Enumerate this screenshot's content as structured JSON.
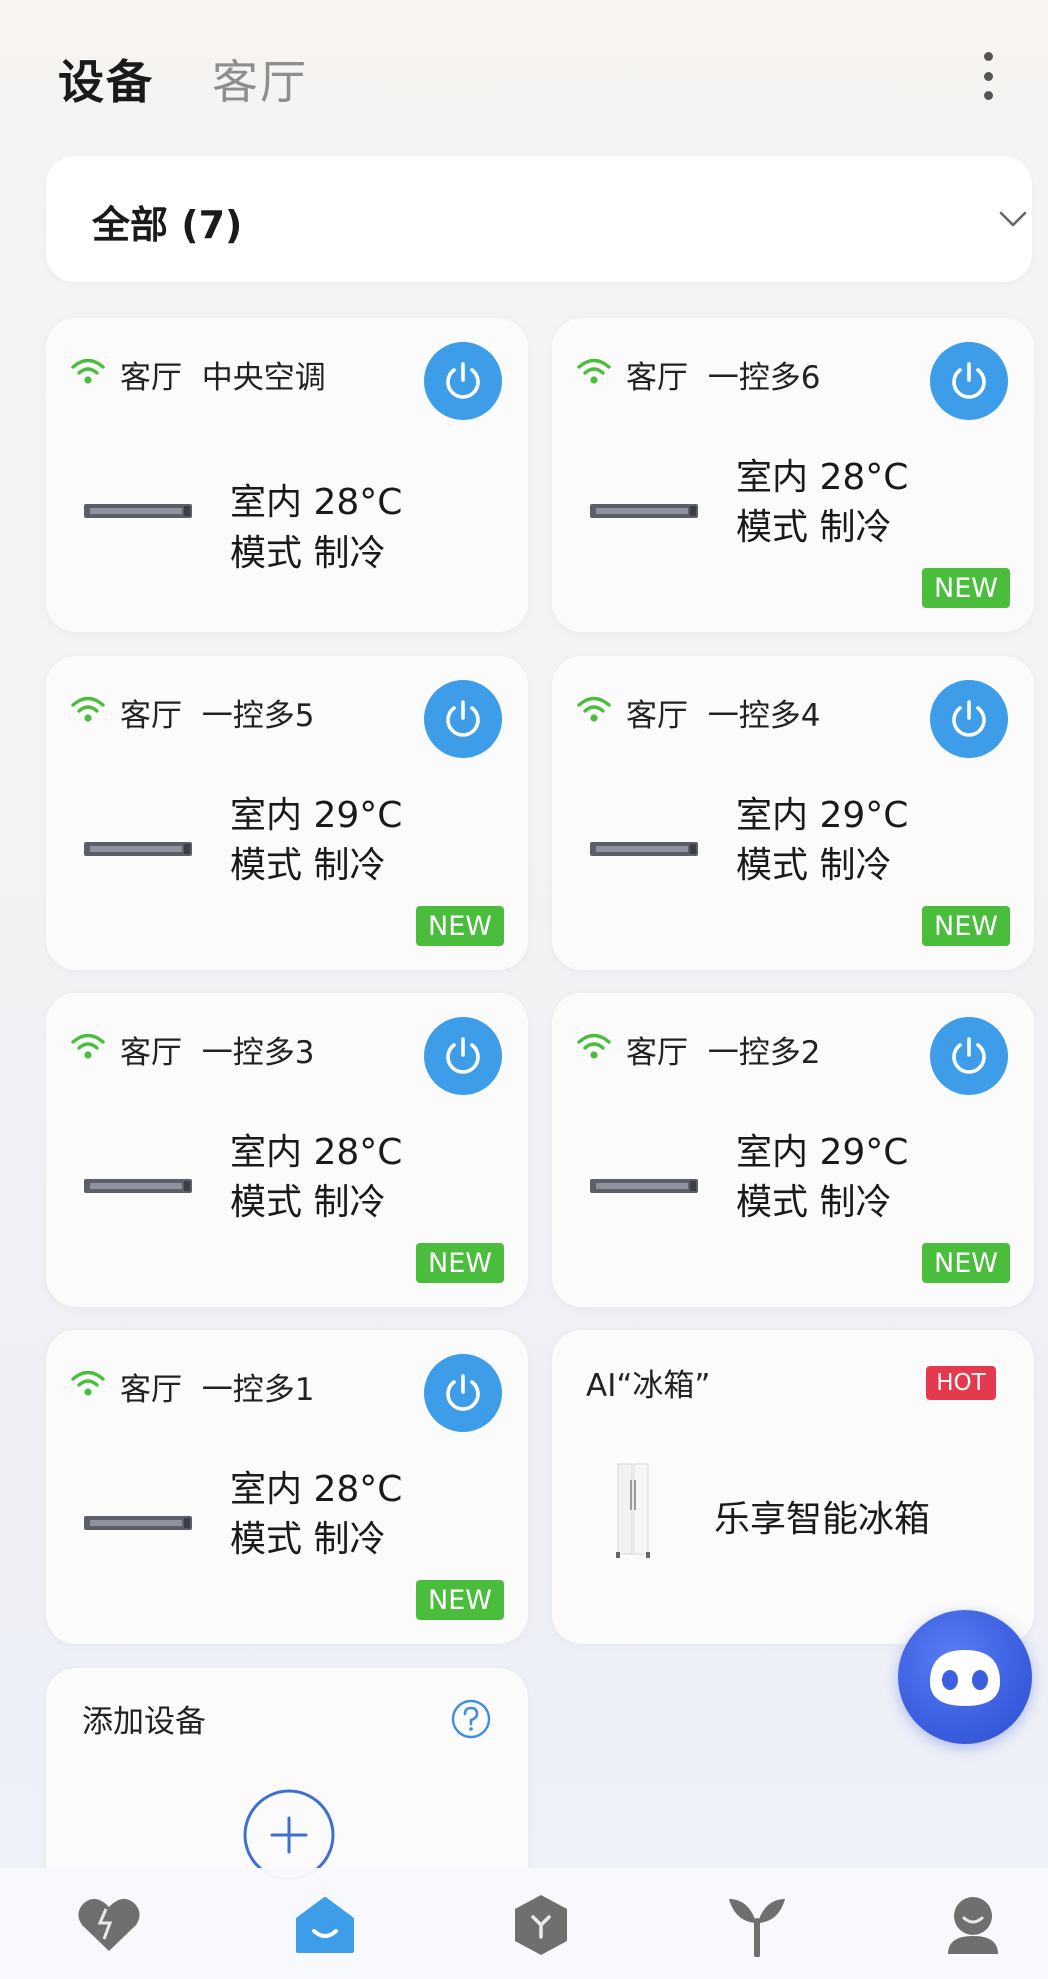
{
  "header": {
    "tabs": [
      {
        "label": "设备",
        "active": true
      },
      {
        "label": "客厅",
        "active": false
      }
    ]
  },
  "filter": {
    "label": "全部 (7)"
  },
  "devices": [
    {
      "room": "客厅",
      "name": "中央空调",
      "indoor": "室内 28°C",
      "mode": "模式 制冷",
      "badge": ""
    },
    {
      "room": "客厅",
      "name": "一控多6",
      "indoor": "室内 28°C",
      "mode": "模式 制冷",
      "badge": "NEW"
    },
    {
      "room": "客厅",
      "name": "一控多5",
      "indoor": "室内 29°C",
      "mode": "模式 制冷",
      "badge": "NEW"
    },
    {
      "room": "客厅",
      "name": "一控多4",
      "indoor": "室内 29°C",
      "mode": "模式 制冷",
      "badge": "NEW"
    },
    {
      "room": "客厅",
      "name": "一控多3",
      "indoor": "室内 28°C",
      "mode": "模式 制冷",
      "badge": "NEW"
    },
    {
      "room": "客厅",
      "name": "一控多2",
      "indoor": "室内 29°C",
      "mode": "模式 制冷",
      "badge": "NEW"
    },
    {
      "room": "客厅",
      "name": "一控多1",
      "indoor": "室内 28°C",
      "mode": "模式 制冷",
      "badge": "NEW"
    }
  ],
  "promo": {
    "title": "AI“冰箱”",
    "badge": "HOT",
    "name": "乐享智能冰箱"
  },
  "add_device": {
    "title": "添加设备"
  },
  "colors": {
    "power": "#3e9de8",
    "wifi": "#4bbd3c",
    "new_badge": "#4bbd3c",
    "hot_badge": "#e53a4e",
    "nav_active": "#3e9de8"
  },
  "nav": {
    "items": [
      "heart-icon",
      "home-icon",
      "cube-icon",
      "sprout-icon",
      "profile-icon"
    ]
  }
}
